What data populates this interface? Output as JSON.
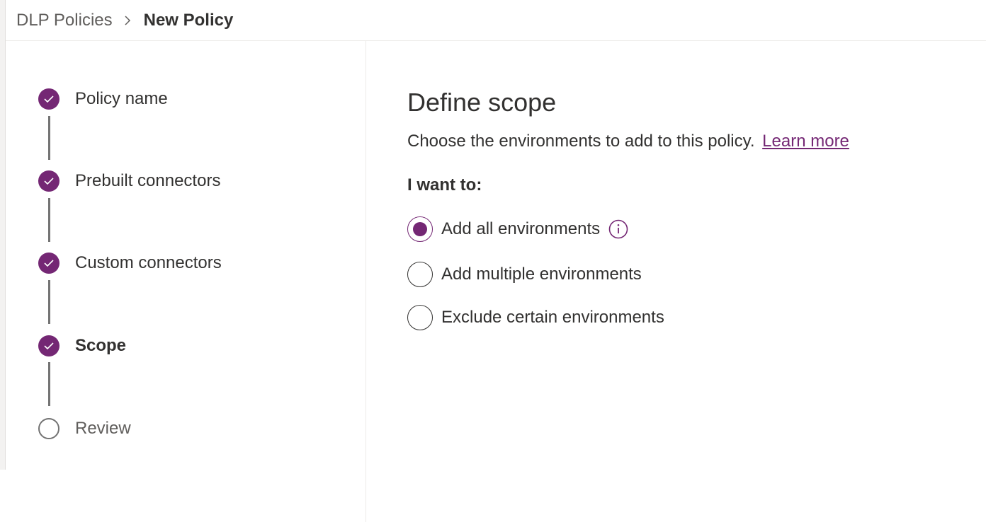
{
  "breadcrumb": {
    "root": "DLP Policies",
    "current": "New Policy"
  },
  "steps": [
    {
      "label": "Policy name",
      "state": "completed"
    },
    {
      "label": "Prebuilt connectors",
      "state": "completed"
    },
    {
      "label": "Custom connectors",
      "state": "completed"
    },
    {
      "label": "Scope",
      "state": "current"
    },
    {
      "label": "Review",
      "state": "pending"
    }
  ],
  "main": {
    "title": "Define scope",
    "description": "Choose the environments to add to this policy.",
    "learn_more": "Learn more",
    "prompt": "I want to:",
    "options": [
      {
        "label": "Add all environments",
        "selected": true
      },
      {
        "label": "Add multiple environments",
        "selected": false
      },
      {
        "label": "Exclude certain environments",
        "selected": false
      }
    ]
  },
  "colors": {
    "accent": "#742774",
    "text": "#323130",
    "muted": "#605e5c",
    "divider": "#edebe9"
  },
  "icons": {
    "breadcrumb_separator": "chevron-right-icon",
    "step_done": "checkmark-icon",
    "info": "info-icon"
  }
}
